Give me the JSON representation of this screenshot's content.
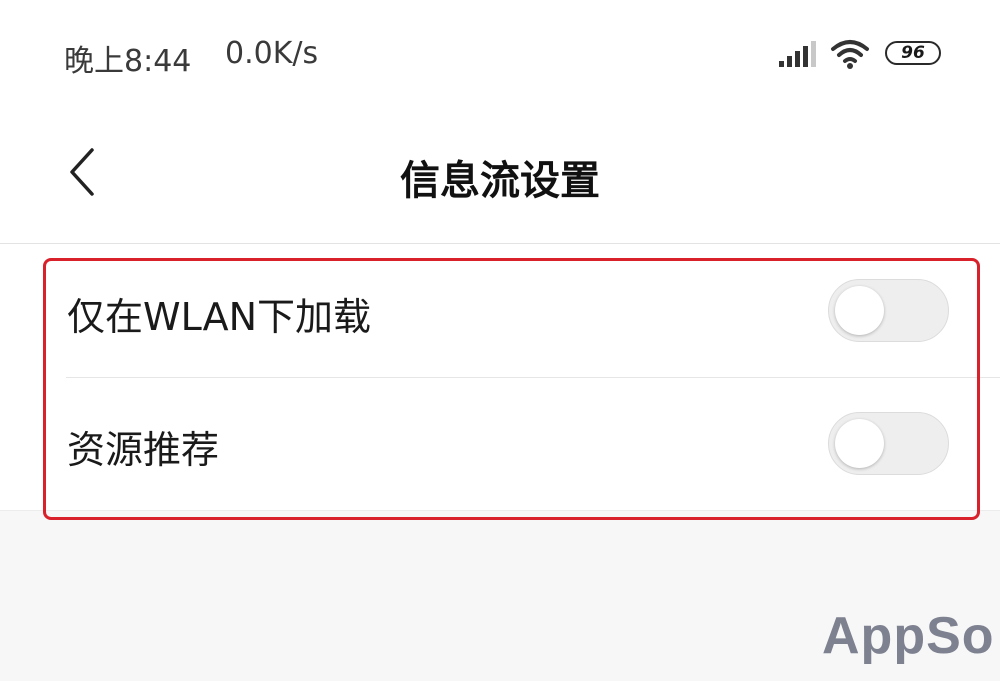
{
  "status_bar": {
    "time": "晚上8:44",
    "net_speed": "0.0K/s",
    "battery": "96",
    "icons": [
      "signal-icon",
      "wifi-icon",
      "battery-icon"
    ]
  },
  "nav": {
    "back_icon": "chevron-left-icon",
    "title": "信息流设置"
  },
  "settings": [
    {
      "label": "仅在WLAN下加载",
      "enabled": false
    },
    {
      "label": "资源推荐",
      "enabled": false
    }
  ],
  "colors": {
    "highlight": "#d9212b",
    "toggle_off": "#eeeeee",
    "background": "#f7f7f7",
    "watermark": "#7d8190"
  },
  "watermark": "AppSo"
}
